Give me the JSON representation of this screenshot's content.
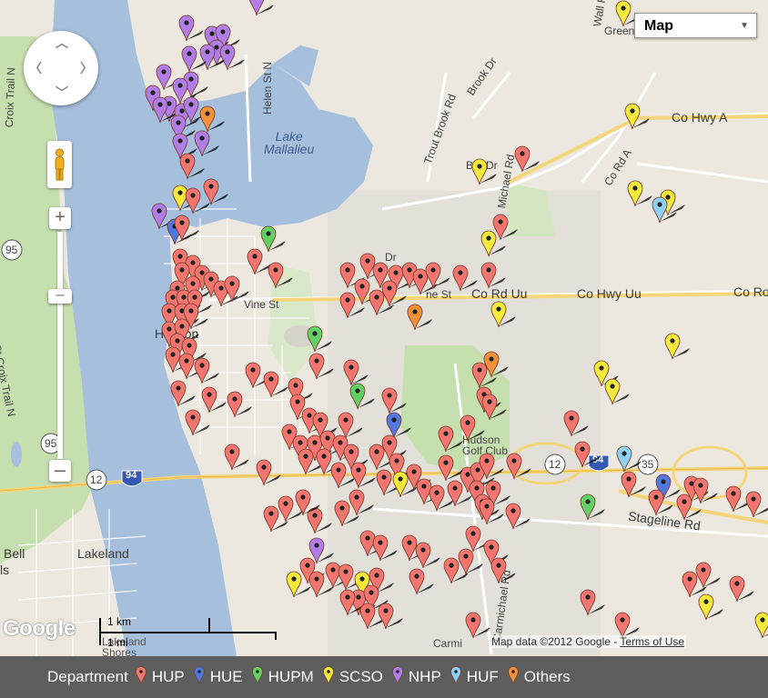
{
  "map_type_control": {
    "selected": "Map"
  },
  "labels": {
    "lake_mallalieu": "Lake\nMallalieu",
    "helen_st": "Helen St N",
    "trout_brook": "Trout Brook Rd",
    "brook_dr": "Brook Dr",
    "wall_rd": "Wall Rd",
    "green": "Green",
    "co_hwy_a": "Co Hwy A",
    "co_rd_a": "Co Rd A",
    "bar_dr": "Bar Dr",
    "michael_rd": "Michael Rd",
    "dr": "Dr",
    "vine_st": "Vine St",
    "vine_st_2": "ne St",
    "co_rd_uu": "Co Rd Uu",
    "co_hwy_uu": "Co Hwy Uu",
    "co_ro": "Co Ro",
    "hudson": "Hudson",
    "hudson_golf": "Hudson\nGolf Club",
    "st_croix_trail": "St Croix Trail N",
    "croix_trail_top": "Croix Trail N",
    "lakeland": "Lakeland",
    "lakeland_shores": "Lakeland\nShores",
    "bell": "Bell",
    "bell_s": "ls",
    "stageline": "Stageline Rd",
    "carmichael": "Carmichael Rd",
    "carmi": "Carmi",
    "shield_95_a": "95",
    "shield_95_b": "95",
    "shield_12_a": "12",
    "shield_12_b": "12",
    "shield_94_a": "94",
    "shield_94_b": "94",
    "shield_35": "35"
  },
  "scale": {
    "label": "1 km",
    "label2": "1 mi"
  },
  "google_logo": "Google",
  "attribution": {
    "text": "Map data ©2012 Google - ",
    "terms": "Terms of Use"
  },
  "legend": {
    "title": "Department",
    "items": [
      {
        "label": "HUP",
        "color": "#f2766f"
      },
      {
        "label": "HUE",
        "color": "#4f79e0"
      },
      {
        "label": "HUPM",
        "color": "#63d063"
      },
      {
        "label": "SCSO",
        "color": "#f4ea3c"
      },
      {
        "label": "NHP",
        "color": "#b07ee6"
      },
      {
        "label": "HUF",
        "color": "#8fd0f5"
      },
      {
        "label": "Others",
        "color": "#f0913a"
      }
    ]
  },
  "colors": {
    "HUP": "#f2766f",
    "HUE": "#4f79e0",
    "HUPM": "#63d063",
    "SCSO": "#f4ea3c",
    "NHP": "#b07ee6",
    "HUF": "#8fd0f5",
    "Others": "#f0913a",
    "water": "#a5bfdd",
    "park": "#c8dfb2",
    "road_major": "#f5d57a"
  },
  "icons": {
    "pan": "pan-control-icon",
    "pegman": "pegman-icon",
    "zoom_in": "zoom-in-icon",
    "zoom_out": "zoom-out-icon"
  }
}
